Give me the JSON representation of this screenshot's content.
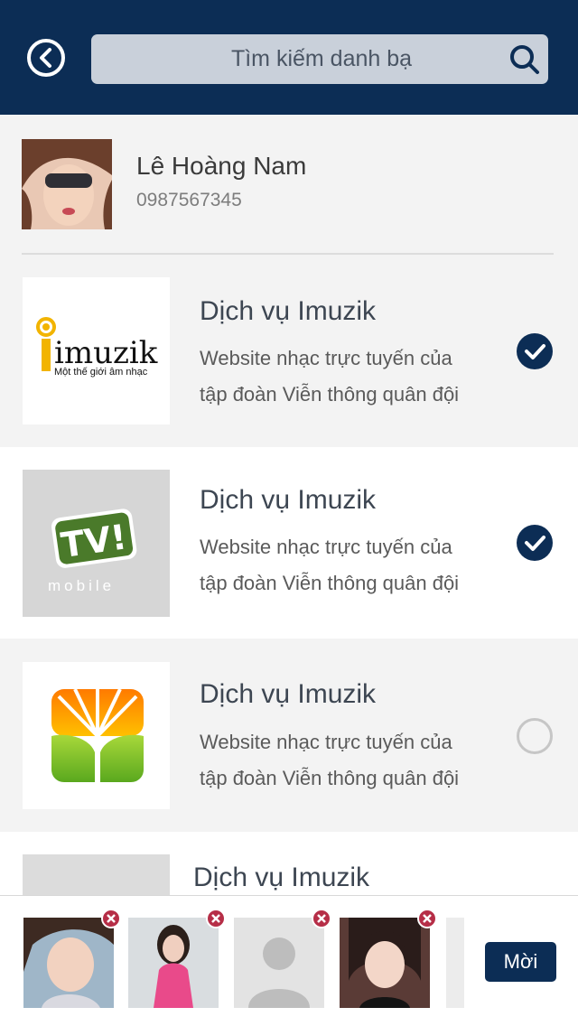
{
  "header": {
    "search_placeholder": "Tìm kiếm danh bạ"
  },
  "contact": {
    "name": "Lê Hoàng Nam",
    "phone": "0987567345"
  },
  "services": [
    {
      "title": "Dịch vụ Imuzik",
      "desc_line1": "Website nhạc trực tuyến của",
      "desc_line2": "tập đoàn Viễn thông quân đội",
      "logo_text": "imuzik",
      "logo_tagline": "Một thế giới âm nhạc",
      "selected": true
    },
    {
      "title": "Dịch vụ Imuzik",
      "desc_line1": "Website nhạc trực tuyến của",
      "desc_line2": "tập đoàn Viễn thông quân đội",
      "logo_text": "TV!",
      "logo_tagline": "mobile",
      "selected": true
    },
    {
      "title": "Dịch vụ Imuzik",
      "desc_line1": "Website nhạc trực tuyến của",
      "desc_line2": "tập đoàn Viễn thông quân đội",
      "selected": false
    },
    {
      "title": "Dịch vụ Imuzik"
    }
  ],
  "bottom": {
    "invite_label": "Mời"
  },
  "colors": {
    "primary": "#0c2d55",
    "remove": "#b62e47",
    "search_bg": "#c9d0da"
  }
}
